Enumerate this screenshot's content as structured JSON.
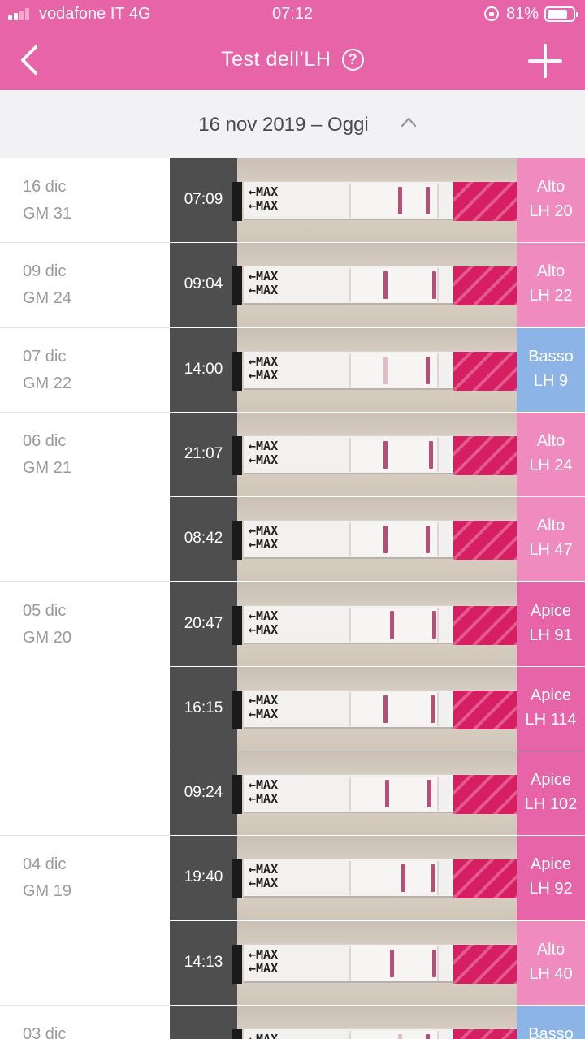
{
  "status_bar": {
    "carrier": "vodafone IT 4G",
    "time": "07:12",
    "battery": "81%",
    "battery_level": 0.81
  },
  "nav": {
    "title": "Test dell’LH",
    "help_icon": "?"
  },
  "range": {
    "label": "16 nov 2019 – Oggi"
  },
  "colors": {
    "brand": "#e864a9",
    "high": "#f08bbf",
    "peak": "#e864a9",
    "low": "#8db4e6"
  },
  "days": [
    {
      "date": "16 dic",
      "gm": "GM 31",
      "tests": [
        {
          "time": "07:09",
          "level": "Alto",
          "lh": "LH 20",
          "kind": "high"
        }
      ]
    },
    {
      "date": "09 dic",
      "gm": "GM 24",
      "tests": [
        {
          "time": "09:04",
          "level": "Alto",
          "lh": "LH 22",
          "kind": "high"
        }
      ]
    },
    {
      "date": "07 dic",
      "gm": "GM 22",
      "tests": [
        {
          "time": "14:00",
          "level": "Basso",
          "lh": "LH 9",
          "kind": "low"
        }
      ]
    },
    {
      "date": "06 dic",
      "gm": "GM 21",
      "tests": [
        {
          "time": "21:07",
          "level": "Alto",
          "lh": "LH 24",
          "kind": "high"
        },
        {
          "time": "08:42",
          "level": "Alto",
          "lh": "LH 47",
          "kind": "high"
        }
      ]
    },
    {
      "date": "05 dic",
      "gm": "GM 20",
      "tests": [
        {
          "time": "20:47",
          "level": "Apice",
          "lh": "LH 91",
          "kind": "peak"
        },
        {
          "time": "16:15",
          "level": "Apice",
          "lh": "LH 114",
          "kind": "peak"
        },
        {
          "time": "09:24",
          "level": "Apice",
          "lh": "LH 102",
          "kind": "peak"
        }
      ]
    },
    {
      "date": "04 dic",
      "gm": "GM 19",
      "tests": [
        {
          "time": "19:40",
          "level": "Apice",
          "lh": "LH 92",
          "kind": "peak"
        },
        {
          "time": "14:13",
          "level": "Alto",
          "lh": "LH 40",
          "kind": "high"
        }
      ]
    },
    {
      "date": "03 dic",
      "gm": "",
      "tests": [
        {
          "time": "",
          "level": "Basso",
          "lh": "",
          "kind": "low"
        }
      ]
    }
  ],
  "strip_label": "←MAX"
}
